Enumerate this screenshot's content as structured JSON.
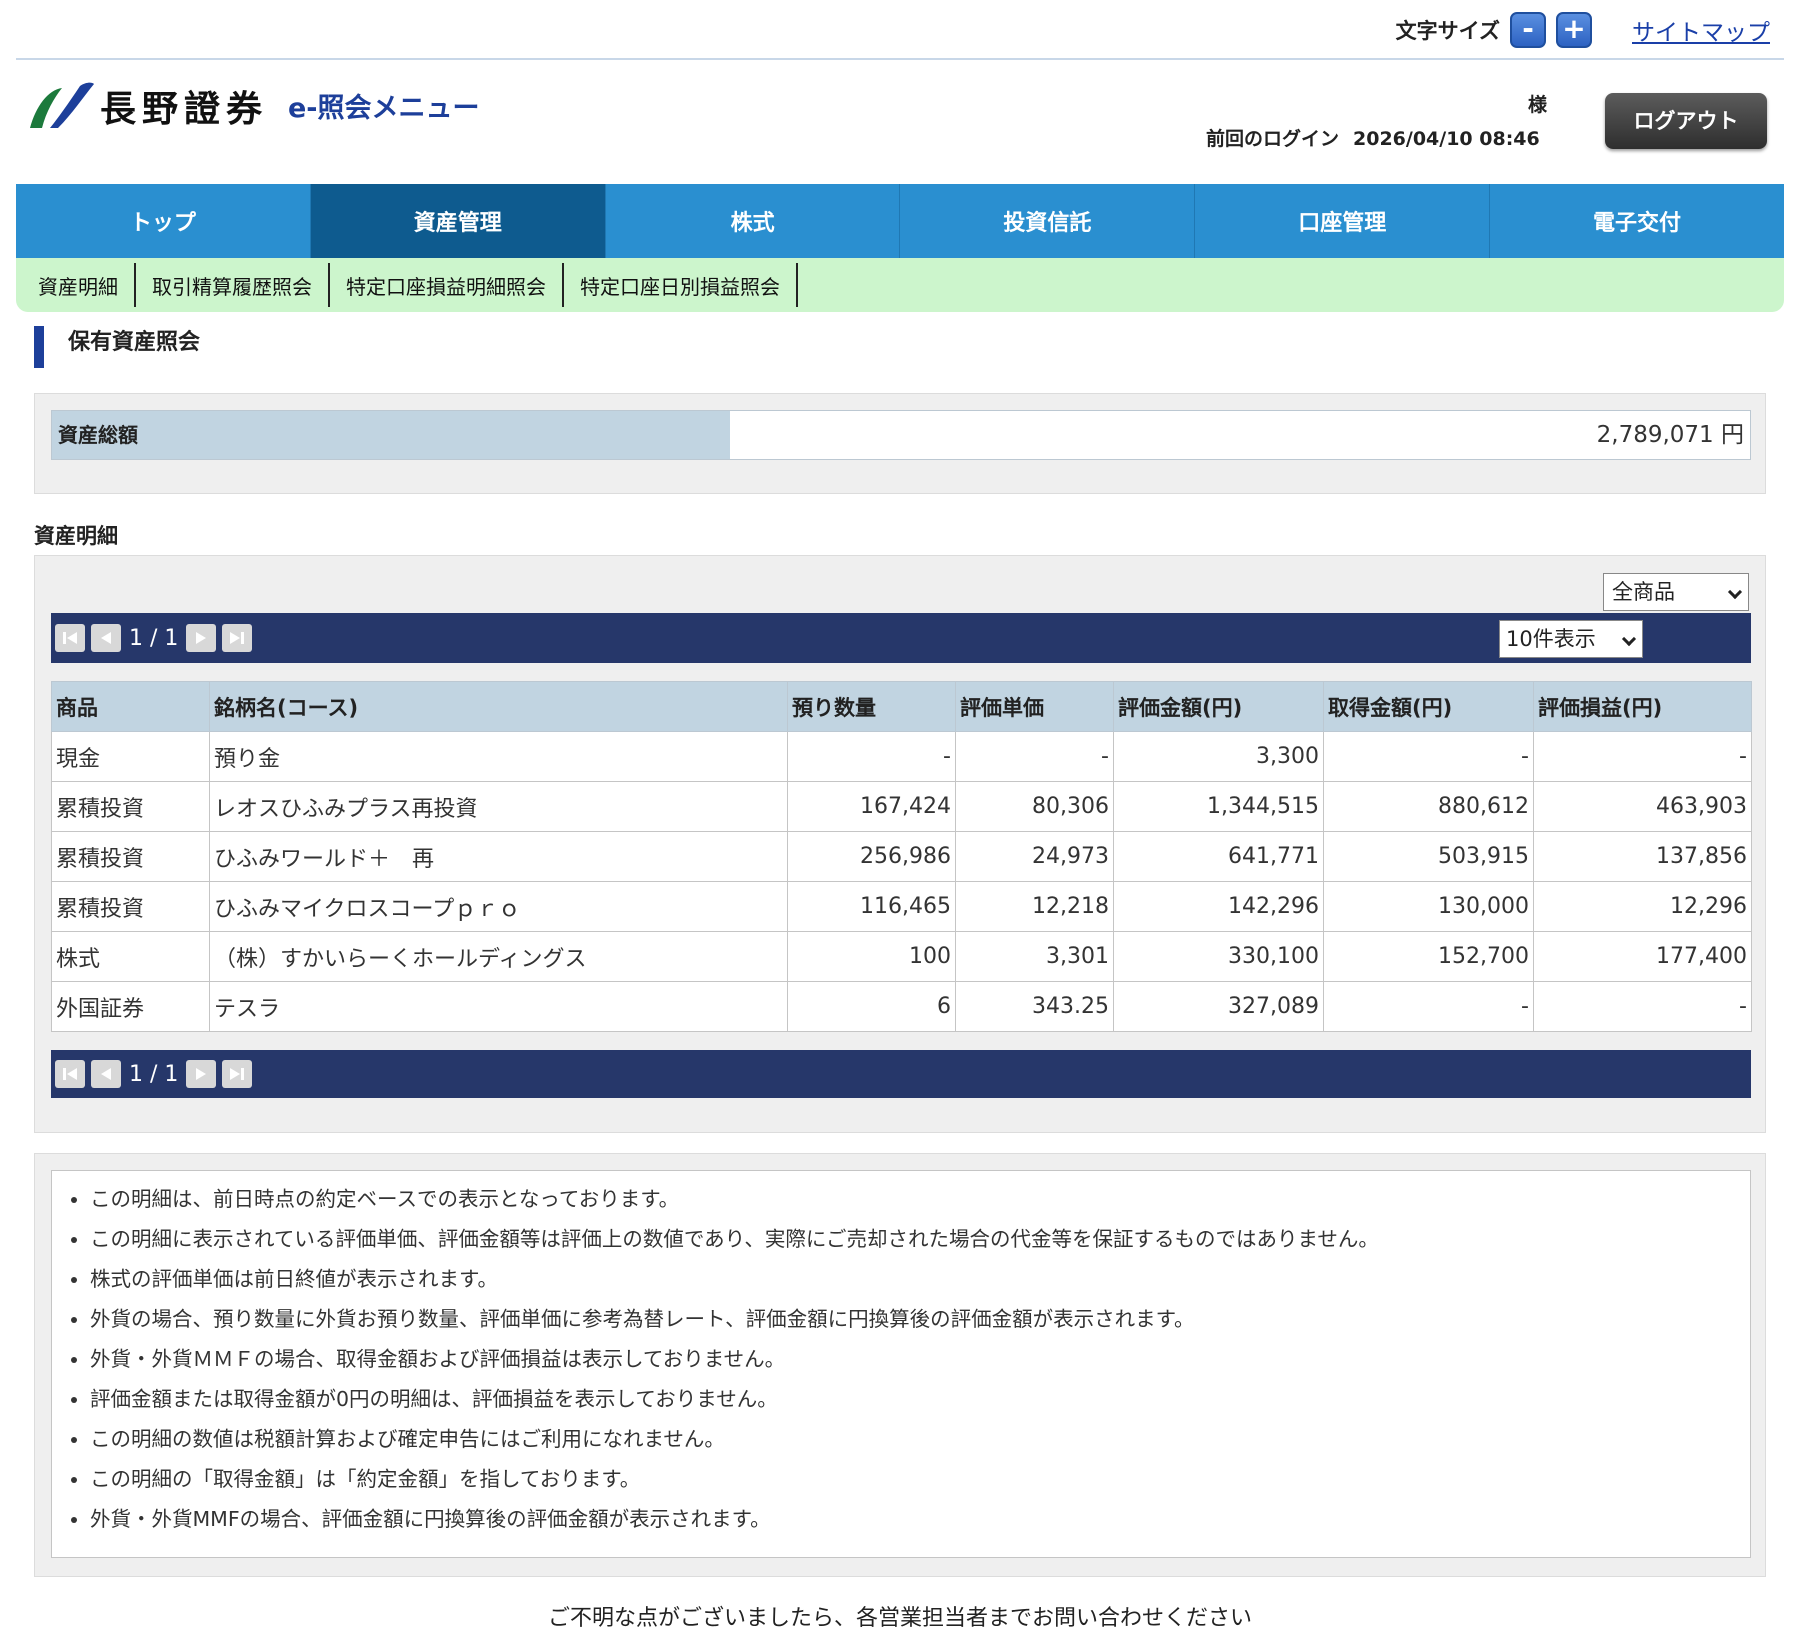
{
  "utility": {
    "font_size_label": "文字サイズ",
    "minus": "-",
    "plus": "+",
    "sitemap": "サイトマップ"
  },
  "header": {
    "company_name": "長野證券",
    "subtitle": "e-照会メニュー",
    "user_suffix": "様",
    "last_login_label": "前回のログイン",
    "last_login_time": "2026/04/10 08:46",
    "logout": "ログアウト",
    "brand_colors": {
      "logo_green": "#1c7a3c",
      "logo_blue": "#1d3f9a"
    }
  },
  "nav": {
    "tabs": [
      {
        "label": "トップ"
      },
      {
        "label": "資産管理",
        "active": true
      },
      {
        "label": "株式"
      },
      {
        "label": "投資信託"
      },
      {
        "label": "口座管理"
      },
      {
        "label": "電子交付"
      }
    ],
    "active_color": "#0e5b8f",
    "color": "#2a8fd0"
  },
  "subnav": {
    "items": [
      {
        "label": "資産明細"
      },
      {
        "label": "取引精算履歴照会"
      },
      {
        "label": "特定口座損益明細照会"
      },
      {
        "label": "特定口座日別損益照会"
      }
    ]
  },
  "page_title": "保有資産照会",
  "total": {
    "label": "資産総額",
    "value": "2,789,071 円"
  },
  "holdings": {
    "section_title": "資産明細",
    "filter": "全商品",
    "per_page": "10件表示",
    "pager": "1 / 1",
    "columns": [
      "商品",
      "銘柄名(コース)",
      "預り数量",
      "評価単価",
      "評価金額(円)",
      "取得金額(円)",
      "評価損益(円)"
    ],
    "rows": [
      [
        "現金",
        "預り金",
        "-",
        "-",
        "3,300",
        "-",
        "-"
      ],
      [
        "累積投資",
        "レオスひふみプラス再投資",
        "167,424",
        "80,306",
        "1,344,515",
        "880,612",
        "463,903"
      ],
      [
        "累積投資",
        "ひふみワールド＋　再",
        "256,986",
        "24,973",
        "641,771",
        "503,915",
        "137,856"
      ],
      [
        "累積投資",
        "ひふみマイクロスコープｐｒｏ",
        "116,465",
        "12,218",
        "142,296",
        "130,000",
        "12,296"
      ],
      [
        "株式",
        "（株）すかいらーくホールディングス",
        "100",
        "3,301",
        "330,100",
        "152,700",
        "177,400"
      ],
      [
        "外国証券",
        "テスラ",
        "6",
        "343.25",
        "327,089",
        "-",
        "-"
      ]
    ]
  },
  "notes": [
    "この明細は、前日時点の約定ベースでの表示となっております。",
    "この明細に表示されている評価単価、評価金額等は評価上の数値であり、実際にご売却された場合の代金等を保証するものではありません。",
    "株式の評価単価は前日終値が表示されます。",
    "外貨の場合、預り数量に外貨お預り数量、評価単価に参考為替レート、評価金額に円換算後の評価金額が表示されます。",
    "外貨・外貨ＭＭＦの場合、取得金額および評価損益は表示しておりません。",
    "評価金額または取得金額が0円の明細は、評価損益を表示しておりません。",
    "この明細の数値は税額計算および確定申告にはご利用になれません。",
    "この明細の「取得金額」は「約定金額」を指しております。",
    "外貨・外貨MMFの場合、評価金額に円換算後の評価金額が表示されます。"
  ],
  "footer": "ご不明な点がございましたら、各営業担当者までお問い合わせください"
}
